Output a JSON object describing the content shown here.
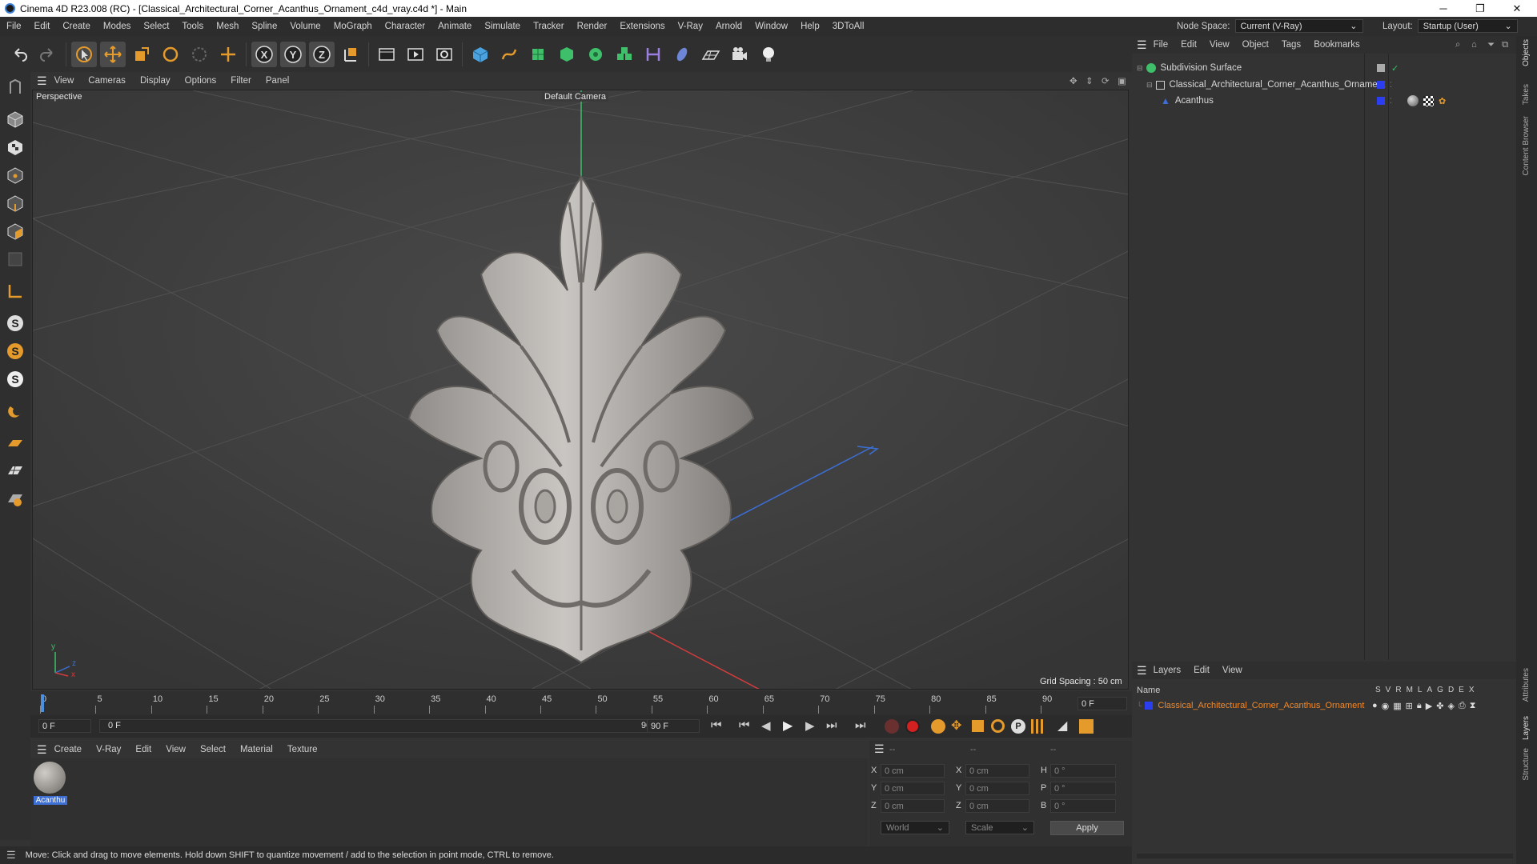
{
  "window": {
    "title": "Cinema 4D R23.008 (RC) - [Classical_Architectural_Corner_Acanthus_Ornament_c4d_vray.c4d *] - Main",
    "minimize": "─",
    "maximize": "❐",
    "close": "✕"
  },
  "menubar": {
    "items": [
      "File",
      "Edit",
      "Create",
      "Modes",
      "Select",
      "Tools",
      "Mesh",
      "Spline",
      "Volume",
      "MoGraph",
      "Character",
      "Animate",
      "Simulate",
      "Tracker",
      "Render",
      "Extensions",
      "V-Ray",
      "Arnold",
      "Window",
      "Help",
      "3DToAll"
    ],
    "node_space_label": "Node Space:",
    "node_space_value": "Current (V-Ray)",
    "layout_label": "Layout:",
    "layout_value": "Startup (User)"
  },
  "viewport": {
    "menu": [
      "View",
      "Cameras",
      "Display",
      "Options",
      "Filter",
      "Panel"
    ],
    "label": "Perspective",
    "camera": "Default Camera",
    "grid_spacing": "Grid Spacing : 50 cm",
    "axis_y": "y",
    "axis_z": "z",
    "axis_x": "x"
  },
  "timeline": {
    "ticks": [
      "0",
      "5",
      "10",
      "15",
      "20",
      "25",
      "30",
      "35",
      "40",
      "45",
      "50",
      "55",
      "60",
      "65",
      "70",
      "75",
      "80",
      "85",
      "90"
    ],
    "current": "0 F"
  },
  "transport": {
    "start": "0 F",
    "range_start": "0 F",
    "range_end": "90 F",
    "end": "90 F"
  },
  "materials": {
    "menu": [
      "Create",
      "V-Ray",
      "Edit",
      "View",
      "Select",
      "Material",
      "Texture"
    ],
    "items": [
      {
        "name": "Acanthu"
      }
    ]
  },
  "coords": {
    "header": [
      "--",
      "--",
      "--"
    ],
    "rows": [
      {
        "axis": "X",
        "pos": "0 cm",
        "axis2": "X",
        "size": "0 cm",
        "rl": "H",
        "rot": "0 °"
      },
      {
        "axis": "Y",
        "pos": "0 cm",
        "axis2": "Y",
        "size": "0 cm",
        "rl": "P",
        "rot": "0 °"
      },
      {
        "axis": "Z",
        "pos": "0 cm",
        "axis2": "Z",
        "size": "0 cm",
        "rl": "B",
        "rot": "0 °"
      }
    ],
    "mode": "World",
    "scale": "Scale",
    "apply": "Apply"
  },
  "status": {
    "text": "Move: Click and drag to move elements. Hold down SHIFT to quantize movement / add to the selection in point mode, CTRL to remove."
  },
  "objects": {
    "menu": [
      "File",
      "Edit",
      "View",
      "Object",
      "Tags",
      "Bookmarks"
    ],
    "items": [
      {
        "name": "Subdivision Surface"
      },
      {
        "name": "Classical_Architectural_Corner_Acanthus_Ornament"
      },
      {
        "name": "Acanthus"
      }
    ]
  },
  "layers": {
    "menu": [
      "Layers",
      "Edit",
      "View"
    ],
    "name_header": "Name",
    "flags": [
      "S",
      "V",
      "R",
      "M",
      "L",
      "A",
      "G",
      "D",
      "E",
      "X"
    ],
    "items": [
      {
        "name": "Classical_Architectural_Corner_Acanthus_Ornament",
        "color": "#2c3ff0"
      }
    ]
  },
  "right_tabs": [
    "Objects",
    "Takes",
    "Content Browser",
    "Attributes",
    "Layers",
    "Structure"
  ],
  "colors": {
    "accent_orange": "#e59a2c",
    "layer_text": "#f08a2c",
    "selection_blue": "#3d6fd4"
  }
}
